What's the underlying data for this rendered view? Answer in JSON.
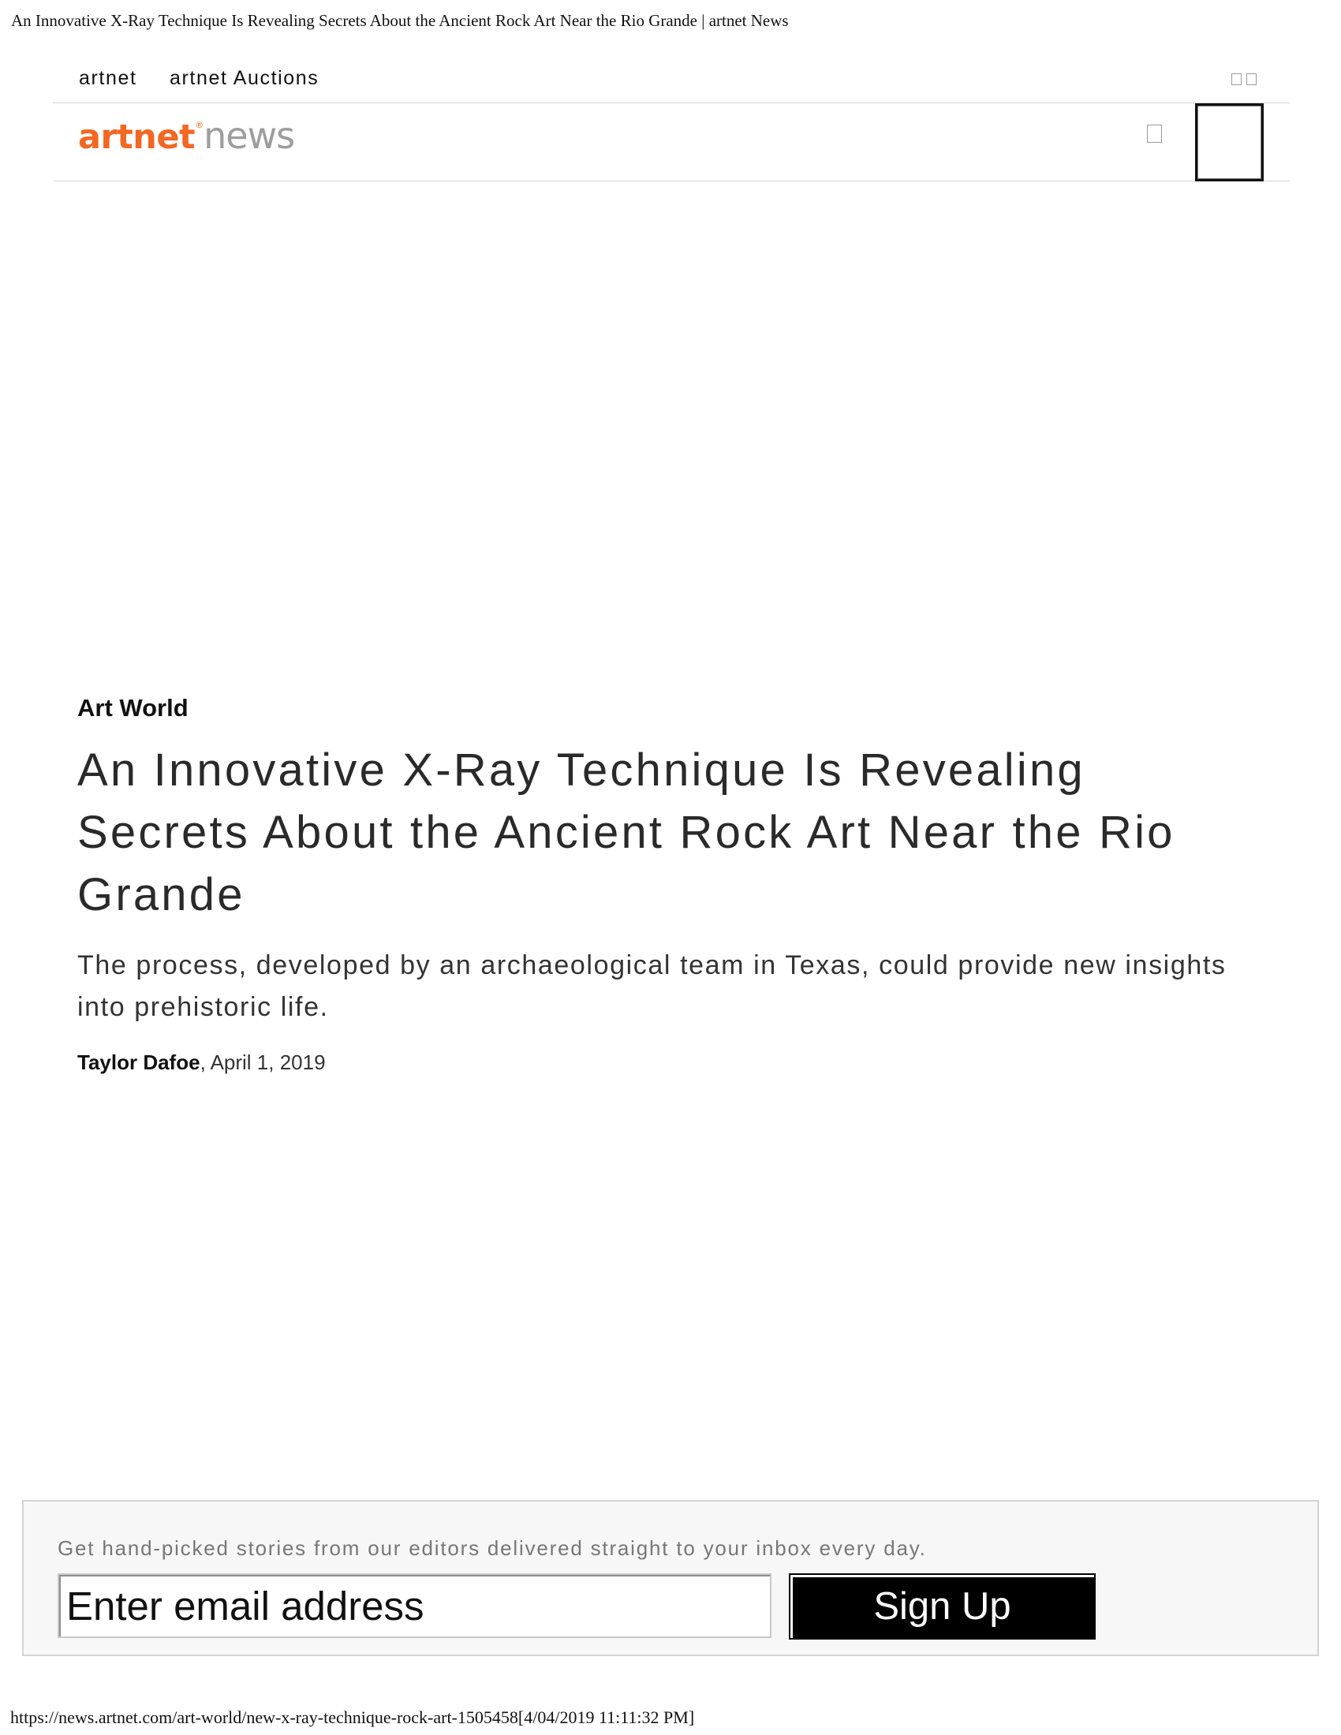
{
  "print_header": "An Innovative X-Ray Technique Is Revealing Secrets About the Ancient Rock Art Near the Rio Grande | artnet News",
  "topbar": {
    "links": [
      "artnet",
      "artnet Auctions"
    ]
  },
  "logo": {
    "brand": "artnet",
    "registered_mark": "®",
    "suffix": "news",
    "brand_color": "#f26722",
    "suffix_color": "#9d9d9d"
  },
  "article": {
    "category": "Art World",
    "headline": "An Innovative X-Ray Technique Is Revealing Secrets About the Ancient Rock Art Near the Rio Grande",
    "dek": "The process, developed by an archaeological team in Texas, could provide new insights into prehistoric life.",
    "author": "Taylor Dafoe",
    "date_text": ", April 1, 2019"
  },
  "newsletter": {
    "prompt": "Get hand-picked stories from our editors delivered straight to your inbox every day.",
    "email_placeholder": "Enter email address",
    "signup_label": "Sign Up"
  },
  "print_footer": "https://news.artnet.com/art-world/new-x-ray-technique-rock-art-1505458[4/04/2019 11:11:32 PM]",
  "icons": {
    "topbar": [
      "social-icon",
      "social-icon"
    ],
    "header": [
      "search-icon",
      "menu-icon"
    ]
  }
}
